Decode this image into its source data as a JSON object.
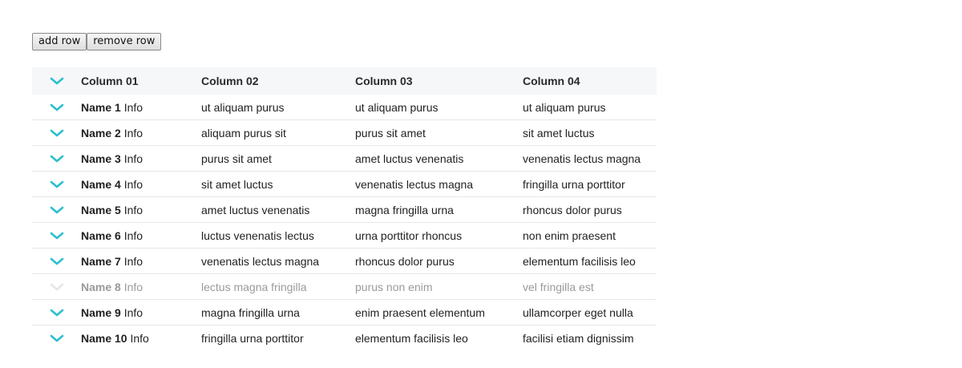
{
  "toolbar": {
    "add_label": "add row",
    "remove_label": "remove row"
  },
  "colors": {
    "accent": "#2bbfd0",
    "accent_dim": "#e6e6e6"
  },
  "table": {
    "headers": [
      "Column 01",
      "Column 02",
      "Column 03",
      "Column 04"
    ],
    "rows": [
      {
        "name": "Name 1",
        "info": "Info",
        "c2": "ut aliquam purus",
        "c3": "ut aliquam purus",
        "c4": "ut aliquam purus",
        "dim": false
      },
      {
        "name": "Name 2",
        "info": "Info",
        "c2": "aliquam purus sit",
        "c3": "purus sit amet",
        "c4": "sit amet luctus",
        "dim": false
      },
      {
        "name": "Name 3",
        "info": "Info",
        "c2": "purus sit amet",
        "c3": "amet luctus venenatis",
        "c4": "venenatis lectus magna",
        "dim": false
      },
      {
        "name": "Name 4",
        "info": "Info",
        "c2": "sit amet luctus",
        "c3": "venenatis lectus magna",
        "c4": "fringilla urna porttitor",
        "dim": false
      },
      {
        "name": "Name 5",
        "info": "Info",
        "c2": "amet luctus venenatis",
        "c3": "magna fringilla urna",
        "c4": "rhoncus dolor purus",
        "dim": false
      },
      {
        "name": "Name 6",
        "info": "Info",
        "c2": "luctus venenatis lectus",
        "c3": "urna porttitor rhoncus",
        "c4": "non enim praesent",
        "dim": false
      },
      {
        "name": "Name 7",
        "info": "Info",
        "c2": "venenatis lectus magna",
        "c3": "rhoncus dolor purus",
        "c4": "elementum facilisis leo",
        "dim": false
      },
      {
        "name": "Name 8",
        "info": "Info",
        "c2": "lectus magna fringilla",
        "c3": "purus non enim",
        "c4": "vel fringilla est",
        "dim": true
      },
      {
        "name": "Name 9",
        "info": "Info",
        "c2": "magna fringilla urna",
        "c3": "enim praesent elementum",
        "c4": "ullamcorper eget nulla",
        "dim": false
      },
      {
        "name": "Name 10",
        "info": "Info",
        "c2": "fringilla urna porttitor",
        "c3": "elementum facilisis leo",
        "c4": "facilisi etiam dignissim",
        "dim": false
      }
    ]
  }
}
